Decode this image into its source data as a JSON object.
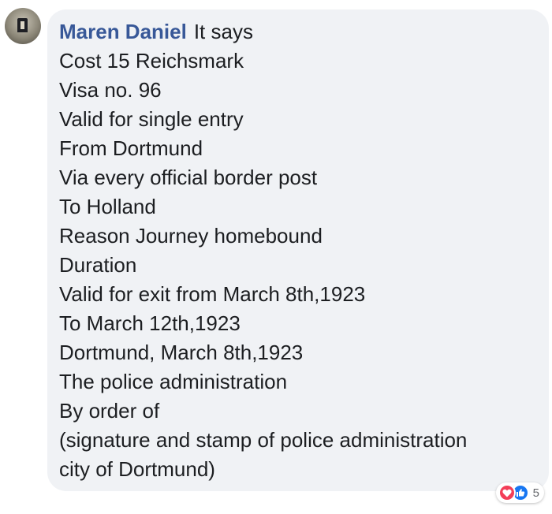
{
  "comment": {
    "author": "Maren Daniel",
    "lines": [
      "It says",
      "Cost 15 Reichsmark",
      "Visa no. 96",
      "Valid for single entry",
      "From Dortmund",
      "Via every official border post",
      "To Holland",
      "Reason Journey homebound",
      "Duration",
      "Valid for exit from March 8th,1923",
      "To March 12th,1923",
      "Dortmund, March 8th,1923",
      "The police administration",
      "By order of",
      "(signature and stamp of police administration",
      "city of Dortmund)"
    ]
  },
  "reactions": {
    "icons": [
      "love-icon",
      "like-icon"
    ],
    "count": "5"
  },
  "colors": {
    "bubble_bg": "#f0f2f5",
    "author": "#385898",
    "text": "#1c1e21",
    "love": "#f33e58",
    "like": "#1877f2"
  }
}
